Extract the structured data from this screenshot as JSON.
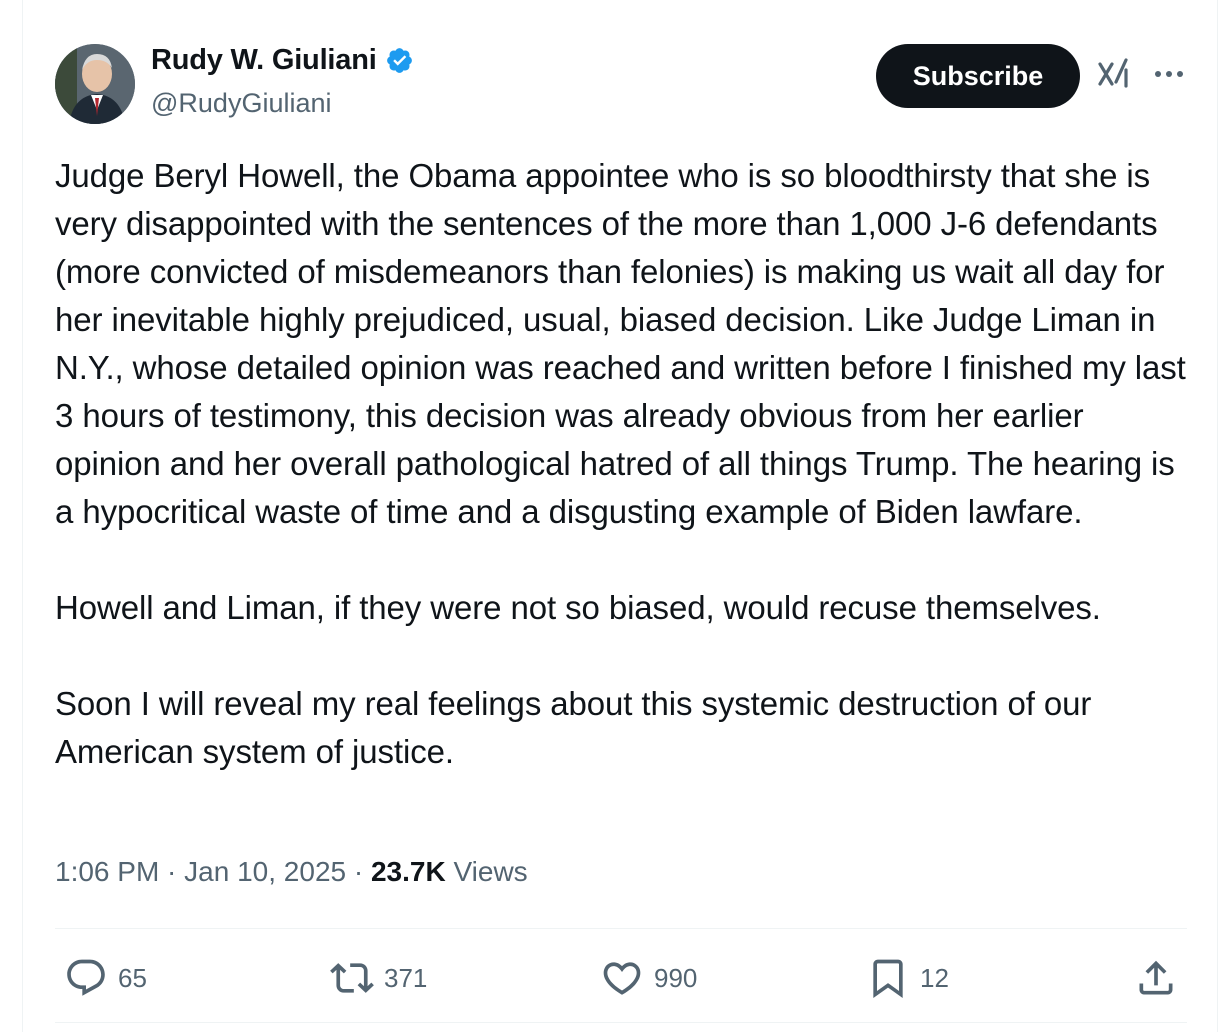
{
  "author": {
    "display_name": "Rudy W. Giuliani",
    "handle": "@RudyGiuliani",
    "verified_color": "#1d9bf0"
  },
  "header": {
    "subscribe_label": "Subscribe",
    "grok_icon": "grok-icon",
    "more_icon": "more-icon"
  },
  "tweet": {
    "paragraphs": [
      "Judge Beryl Howell, the Obama appointee who is so bloodthirsty that she is very disappointed with the sentences of the more than 1,000 J-6 defendants (more convicted of misdemeanors than felonies) is making us wait all day for her inevitable highly prejudiced, usual, biased decision. Like Judge Liman in N.Y., whose detailed opinion was reached and written before I finished my last 3 hours of testimony, this decision was already obvious from her earlier opinion and her overall pathological hatred of all things Trump. The hearing is a hypocritical waste of time and a disgusting example of Biden lawfare.",
      "Howell and Liman, if they were not so biased, would recuse themselves.",
      "Soon I will reveal my real feelings about this systemic destruction of our American system of justice."
    ]
  },
  "meta": {
    "time": "1:06 PM",
    "separator": " · ",
    "date": "Jan 10, 2025",
    "views_count": "23.7K",
    "views_label": " Views"
  },
  "actions": {
    "replies": "65",
    "reposts": "371",
    "likes": "990",
    "bookmarks": "12"
  },
  "colors": {
    "text": "#0f1419",
    "secondary": "#536471",
    "divider": "#eff3f4",
    "button_bg": "#0f1419"
  }
}
